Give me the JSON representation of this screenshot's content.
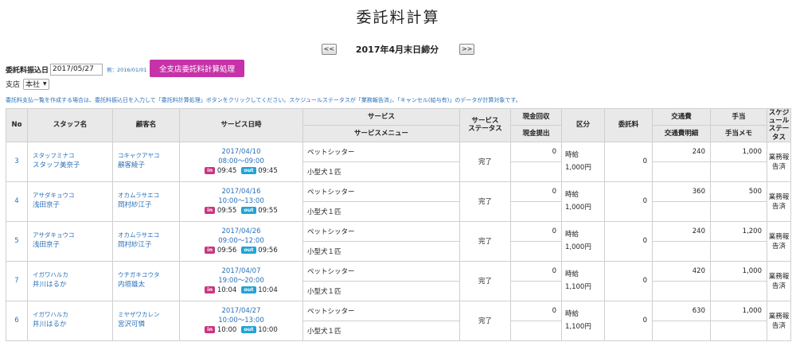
{
  "page_title": "委託料計算",
  "period": {
    "prev_label": "<<",
    "label": "2017年4月末日締分",
    "next_label": ">>"
  },
  "transfer_date": {
    "label": "委託料振込日",
    "value": "2017/05/27",
    "example": "例：2016/01/01"
  },
  "calc_button_label": "全支店委託料計算処理",
  "branch": {
    "label": "支店",
    "selected": "本社"
  },
  "notice": "委託料支払一覧を作成する場合は、委託料振込日を入力して「委託料計算処理」ボタンをクリックしてください。スケジュールステータスが「業務報告済」、「キャンセル(給与有)」のデータが計算対象です。",
  "headers": {
    "no": "No",
    "staff": "スタッフ名",
    "customer": "顧客名",
    "service_datetime": "サービス日時",
    "service": "サービス",
    "service_menu": "サービスメニュー",
    "service_status": "サービス\nステータス",
    "cash_collect": "現金回収",
    "cash_submit": "現金提出",
    "category": "区分",
    "commission": "委託料",
    "transport": "交通費",
    "transport_detail": "交通費明細",
    "allowance": "手当",
    "allowance_memo": "手当メモ",
    "schedule_status": "スケジュール\nステータス"
  },
  "rows": [
    {
      "no": "3",
      "staff_kana": "スタッフミナコ",
      "staff_name": "スタッフ美奈子",
      "customer_kana": "コキャクアヤコ",
      "customer_name": "顧客綾子",
      "date": "2017/04/10",
      "time": "08:00～09:00",
      "in_label": "in",
      "in_time": "09:45",
      "out_label": "out",
      "out_time": "09:45",
      "service": "ペットシッター",
      "menu": "小型犬１匹",
      "status": "完了",
      "cash_collect": "0",
      "cash_submit": "",
      "category": "時給",
      "rate": "1,000円",
      "commission": "0",
      "transport": "240",
      "transport_detail": "",
      "allowance": "1,000",
      "allowance_memo": "",
      "schedule_status": "業務報告済"
    },
    {
      "no": "4",
      "staff_kana": "アサダキョウコ",
      "staff_name": "浅田京子",
      "customer_kana": "オカムラサエコ",
      "customer_name": "岡村紗江子",
      "date": "2017/04/16",
      "time": "10:00～13:00",
      "in_label": "in",
      "in_time": "09:55",
      "out_label": "out",
      "out_time": "09:55",
      "service": "ペットシッター",
      "menu": "小型犬１匹",
      "status": "完了",
      "cash_collect": "0",
      "cash_submit": "",
      "category": "時給",
      "rate": "1,000円",
      "commission": "0",
      "transport": "360",
      "transport_detail": "",
      "allowance": "500",
      "allowance_memo": "",
      "schedule_status": "業務報告済"
    },
    {
      "no": "5",
      "staff_kana": "アサダキョウコ",
      "staff_name": "浅田京子",
      "customer_kana": "オカムラサエコ",
      "customer_name": "岡村紗江子",
      "date": "2017/04/26",
      "time": "09:00～12:00",
      "in_label": "in",
      "in_time": "09:56",
      "out_label": "out",
      "out_time": "09:56",
      "service": "ペットシッター",
      "menu": "小型犬１匹",
      "status": "完了",
      "cash_collect": "0",
      "cash_submit": "",
      "category": "時給",
      "rate": "1,000円",
      "commission": "0",
      "transport": "240",
      "transport_detail": "",
      "allowance": "1,200",
      "allowance_memo": "",
      "schedule_status": "業務報告済"
    },
    {
      "no": "7",
      "staff_kana": "イガワハルカ",
      "staff_name": "井川はるか",
      "customer_kana": "ウチガキユウタ",
      "customer_name": "内垣雄太",
      "date": "2017/04/07",
      "time": "19:00～20:00",
      "in_label": "in",
      "in_time": "10:04",
      "out_label": "out",
      "out_time": "10:04",
      "service": "ペットシッター",
      "menu": "小型犬１匹",
      "status": "完了",
      "cash_collect": "0",
      "cash_submit": "",
      "category": "時給",
      "rate": "1,100円",
      "commission": "0",
      "transport": "420",
      "transport_detail": "",
      "allowance": "1,000",
      "allowance_memo": "",
      "schedule_status": "業務報告済"
    },
    {
      "no": "6",
      "staff_kana": "イガワハルカ",
      "staff_name": "井川はるか",
      "customer_kana": "ミヤザワカレン",
      "customer_name": "宮沢可憐",
      "date": "2017/04/27",
      "time": "10:00～13:00",
      "in_label": "in",
      "in_time": "10:00",
      "out_label": "out",
      "out_time": "10:00",
      "service": "ペットシッター",
      "menu": "小型犬１匹",
      "status": "完了",
      "cash_collect": "0",
      "cash_submit": "",
      "category": "時給",
      "rate": "1,100円",
      "commission": "0",
      "transport": "630",
      "transport_detail": "",
      "allowance": "1,000",
      "allowance_memo": "",
      "schedule_status": "業務報告済"
    }
  ]
}
